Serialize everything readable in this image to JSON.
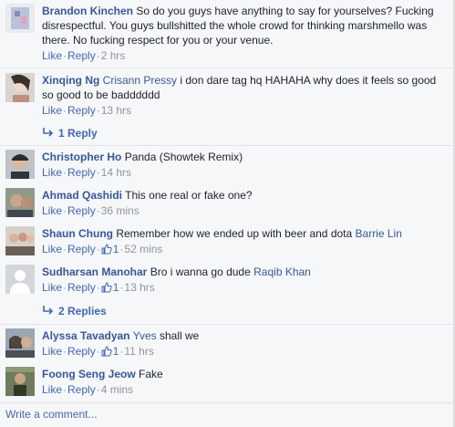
{
  "labels": {
    "like": "Like",
    "reply": "Reply",
    "sep": "·"
  },
  "comments": [
    {
      "name": "Brandon Kinchen",
      "tag": "",
      "text": "So do you guys have anything to say for yourselves? Fucking disrespectful. You guys bullshitted the whole crowd for thinking marshmello was there. No fucking respect for you or your venue.",
      "time": "2 hrs",
      "likes": ""
    },
    {
      "name": "Xinqing Ng",
      "tag": "Crisann Pressy",
      "text": "i don dare tag hq HAHAHA why does it feels so good so good to be badddddd",
      "time": "13 hrs",
      "likes": ""
    },
    {
      "name": "Christopher Ho",
      "tag": "",
      "text": "Panda (Showtek Remix)",
      "time": "14 hrs",
      "likes": ""
    },
    {
      "name": "Ahmad Qashidi",
      "tag": "",
      "text": "This one real or fake one?",
      "time": "36 mins",
      "likes": ""
    },
    {
      "name": "Shaun Chung",
      "tag": "",
      "text": "Remember how we ended up with beer and dota",
      "tag_after": "Barrie Lin",
      "time": "52 mins",
      "likes": "1"
    },
    {
      "name": "Sudharsan Manohar",
      "tag": "",
      "text": "Bro i wanna go dude",
      "tag_after": "Raqib Khan",
      "time": "13 hrs",
      "likes": "1"
    },
    {
      "name": "Alyssa Tavadyan",
      "tag": "Yves",
      "text": "shall we",
      "time": "11 hrs",
      "likes": "1"
    },
    {
      "name": "Foong Seng Jeow",
      "tag": "",
      "text": "Fake",
      "time": "4 mins",
      "likes": ""
    }
  ],
  "reply_links": {
    "first": "1 Reply",
    "second": "2 Replies"
  },
  "write_comment": "Write a comment...",
  "colors": {
    "link": "#4267b2",
    "name": "#365899",
    "meta": "#90949c",
    "background": "#f6f7f9"
  }
}
